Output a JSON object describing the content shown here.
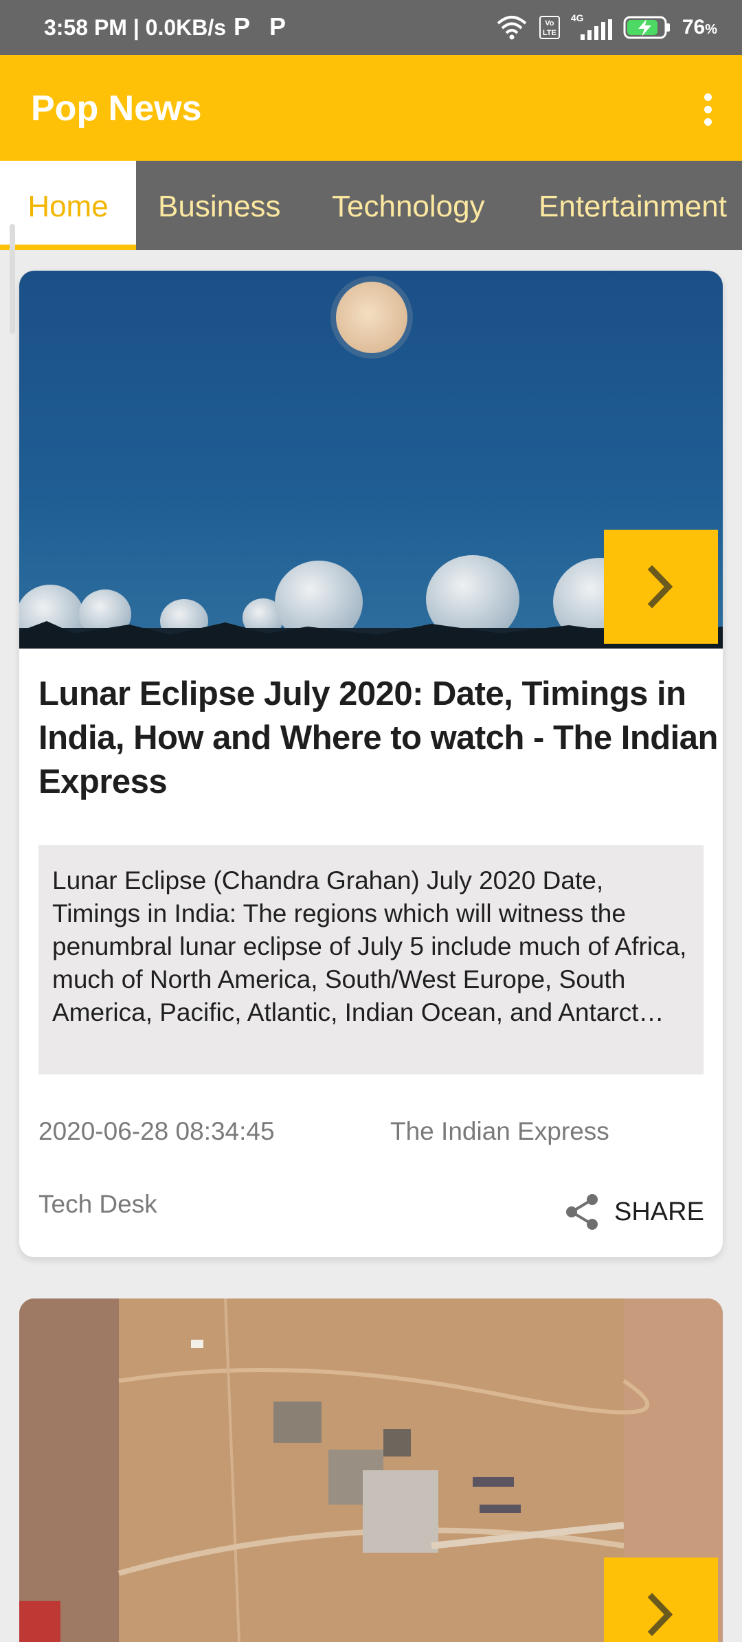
{
  "status_bar": {
    "time_speed": "3:58 PM | 0.0KB/s",
    "notif_icons": [
      "P",
      "P"
    ],
    "network_label": "4G",
    "volte_label": "Vo LTE",
    "battery": "76",
    "battery_unit": "%"
  },
  "app": {
    "title": "Pop News",
    "accent_color": "#ffc107",
    "menu_icon": "overflow-menu-icon"
  },
  "tabs": [
    {
      "label": "Home",
      "selected": true
    },
    {
      "label": "Business",
      "selected": false
    },
    {
      "label": "Technology",
      "selected": false
    },
    {
      "label": "Entertainment",
      "selected": false
    }
  ],
  "articles": [
    {
      "headline": "Lunar Eclipse July 2020: Date, Timings in India, How and Where to watch - The Indian Express",
      "description": "Lunar Eclipse (Chandra Grahan) July 2020 Date, Timings in India: The regions which will witness the penumbral lunar eclipse of July 5 include much of Africa, much of North America, South/West Europe, South America, Pacific, Atlantic, Indian Ocean, and Antarct…",
      "date": "2020-06-28 08:34:45",
      "source": "The Indian Express",
      "author": "Tech Desk",
      "share_label": "SHARE",
      "image_icon": "moon-radar-domes-image"
    },
    {
      "image_icon": "satellite-aerial-image"
    }
  ]
}
